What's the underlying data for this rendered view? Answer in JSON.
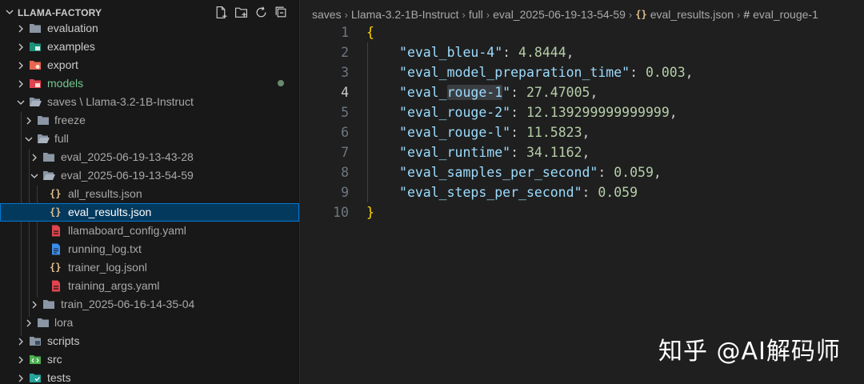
{
  "explorer": {
    "workspace_title": "LLAMA-FACTORY",
    "tree": [
      {
        "label": "evaluation",
        "type": "folder",
        "depth": 0,
        "expanded": false
      },
      {
        "label": "examples",
        "type": "folder-examples",
        "depth": 0,
        "expanded": false
      },
      {
        "label": "export",
        "type": "folder-export",
        "depth": 0,
        "expanded": false
      },
      {
        "label": "models",
        "type": "folder-models",
        "depth": 0,
        "expanded": false,
        "status": "modified"
      },
      {
        "label": "saves",
        "sublabel": "Llama-3.2-1B-Instruct",
        "type": "folder",
        "depth": 0,
        "expanded": true
      },
      {
        "label": "freeze",
        "type": "folder",
        "depth": 1,
        "expanded": false
      },
      {
        "label": "full",
        "type": "folder",
        "depth": 1,
        "expanded": true
      },
      {
        "label": "eval_2025-06-19-13-43-28",
        "type": "folder",
        "depth": 2,
        "expanded": false
      },
      {
        "label": "eval_2025-06-19-13-54-59",
        "type": "folder",
        "depth": 2,
        "expanded": true
      },
      {
        "label": "all_results.json",
        "type": "json",
        "depth": 3
      },
      {
        "label": "eval_results.json",
        "type": "json",
        "depth": 3,
        "selected": true
      },
      {
        "label": "llamaboard_config.yaml",
        "type": "yaml",
        "depth": 3
      },
      {
        "label": "running_log.txt",
        "type": "txt",
        "depth": 3
      },
      {
        "label": "trainer_log.jsonl",
        "type": "json",
        "depth": 3
      },
      {
        "label": "training_args.yaml",
        "type": "yaml",
        "depth": 3
      },
      {
        "label": "train_2025-06-16-14-35-04",
        "type": "folder",
        "depth": 2,
        "expanded": false
      },
      {
        "label": "lora",
        "type": "folder",
        "depth": 1,
        "expanded": false
      },
      {
        "label": "scripts",
        "type": "folder-scripts",
        "depth": 0,
        "expanded": false
      },
      {
        "label": "src",
        "type": "folder-src",
        "depth": 0,
        "expanded": false
      },
      {
        "label": "tests",
        "type": "folder-tests",
        "depth": 0,
        "expanded": false
      }
    ],
    "actions": [
      "new-file-icon",
      "new-folder-icon",
      "refresh-icon",
      "collapse-all-icon"
    ]
  },
  "breadcrumb": {
    "items": [
      "saves",
      "Llama-3.2-1B-Instruct",
      "full",
      "eval_2025-06-19-13-54-59",
      "eval_results.json",
      "eval_rouge-1"
    ],
    "file_icon": "{}",
    "symbol_icon": "#"
  },
  "editor": {
    "active_line": 4,
    "highlight_word": "rouge-1",
    "open_brace": "{",
    "close_brace": "}",
    "entries": [
      {
        "key": "eval_bleu-4",
        "value": "4.8444"
      },
      {
        "key": "eval_model_preparation_time",
        "value": "0.003"
      },
      {
        "key": "eval_rouge-1",
        "value": "27.47005"
      },
      {
        "key": "eval_rouge-2",
        "value": "12.139299999999999"
      },
      {
        "key": "eval_rouge-l",
        "value": "11.5823"
      },
      {
        "key": "eval_runtime",
        "value": "34.1162"
      },
      {
        "key": "eval_samples_per_second",
        "value": "0.059"
      },
      {
        "key": "eval_steps_per_second",
        "value": "0.059"
      }
    ],
    "line_numbers": [
      "1",
      "2",
      "3",
      "4",
      "5",
      "6",
      "7",
      "8",
      "9",
      "10"
    ]
  },
  "watermark": "知乎 @AI解码师",
  "colors": {
    "sidebar_bg": "#181818",
    "editor_bg": "#1f1f1f",
    "selection": "#04395e",
    "json_key": "#9cdcfe",
    "json_number": "#b5cea8",
    "brace": "#ffd700",
    "modified_folder": "#73c991"
  }
}
